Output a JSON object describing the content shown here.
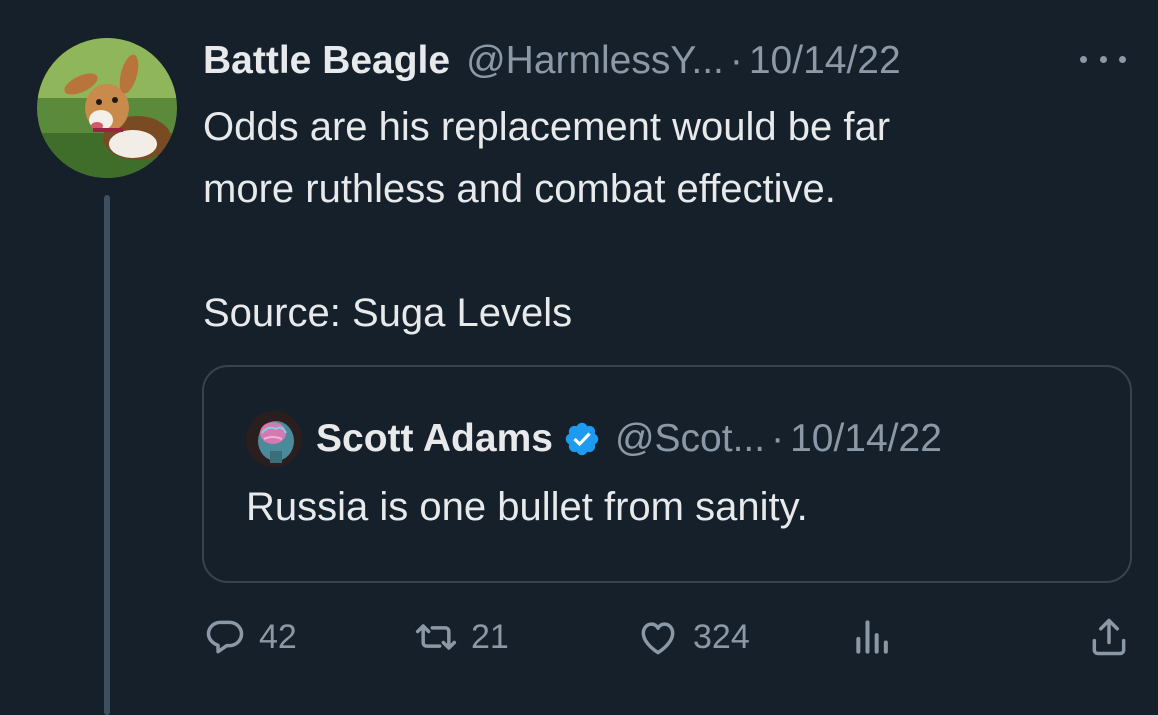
{
  "tweet": {
    "author_name": "Battle Beagle",
    "author_handle": "@HarmlessY...",
    "separator": "·",
    "date": "10/14/22",
    "text_line1": "Odds are his replacement would be far",
    "text_line2": "more ruthless and combat effective.",
    "text_line3": "Source: Suga Levels"
  },
  "quote": {
    "author_name": "Scott Adams",
    "author_handle": "@Scot...",
    "separator": "·",
    "date": "10/14/22",
    "text": "Russia is one bullet from sanity."
  },
  "actions": {
    "replies": "42",
    "retweets": "21",
    "likes": "324"
  },
  "colors": {
    "background": "#15202b",
    "text_primary": "#e7e9ea",
    "text_secondary": "#8b98a5",
    "verified_badge": "#1d9bf0",
    "card_border": "#38444d"
  },
  "icons": [
    "more-icon",
    "verified-badge-icon",
    "reply-icon",
    "retweet-icon",
    "like-icon",
    "views-icon",
    "share-icon"
  ]
}
